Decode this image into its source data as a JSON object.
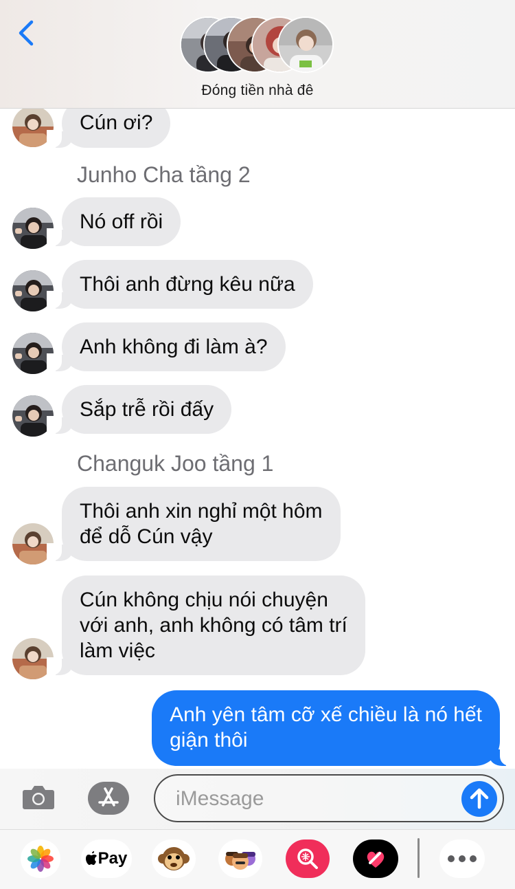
{
  "header": {
    "title": "Đóng tiền nhà đê",
    "back_icon": "chevron-left-icon"
  },
  "colors": {
    "accent": "#1a7af8",
    "incoming_bubble": "#e9e9eb",
    "sender_label": "#6d6d72"
  },
  "messages": {
    "m1": "Cún ơi?",
    "sender_junho": "Junho Cha tầng 2",
    "m2": "Nó off rồi",
    "m3": "Thôi anh đừng kêu nữa",
    "m4": "Anh không đi làm à?",
    "m5": "Sắp trễ rồi đấy",
    "sender_changuk": "Changuk Joo tầng 1",
    "m6_line1": "Thôi anh xin nghỉ một hôm",
    "m6_line2": "để dỗ Cún vậy",
    "m7_line1": "Cún không chịu nói chuyện",
    "m7_line2": "với anh, anh không có tâm trí",
    "m7_line3": "làm việc",
    "out_line1": "Anh yên tâm cỡ xế chiều là nó hết",
    "out_line2": "giận thôi"
  },
  "compose": {
    "placeholder": "iMessage",
    "camera_icon": "camera-icon",
    "apps_icon": "app-store-icon",
    "send_icon": "arrow-up-icon"
  },
  "drawer": {
    "apple_pay_label": "Pay",
    "apps": [
      "photos-icon",
      "apple-pay-icon",
      "animoji-monkey-icon",
      "memoji-icon",
      "search-images-icon",
      "digital-touch-icon",
      "more-icon"
    ]
  }
}
